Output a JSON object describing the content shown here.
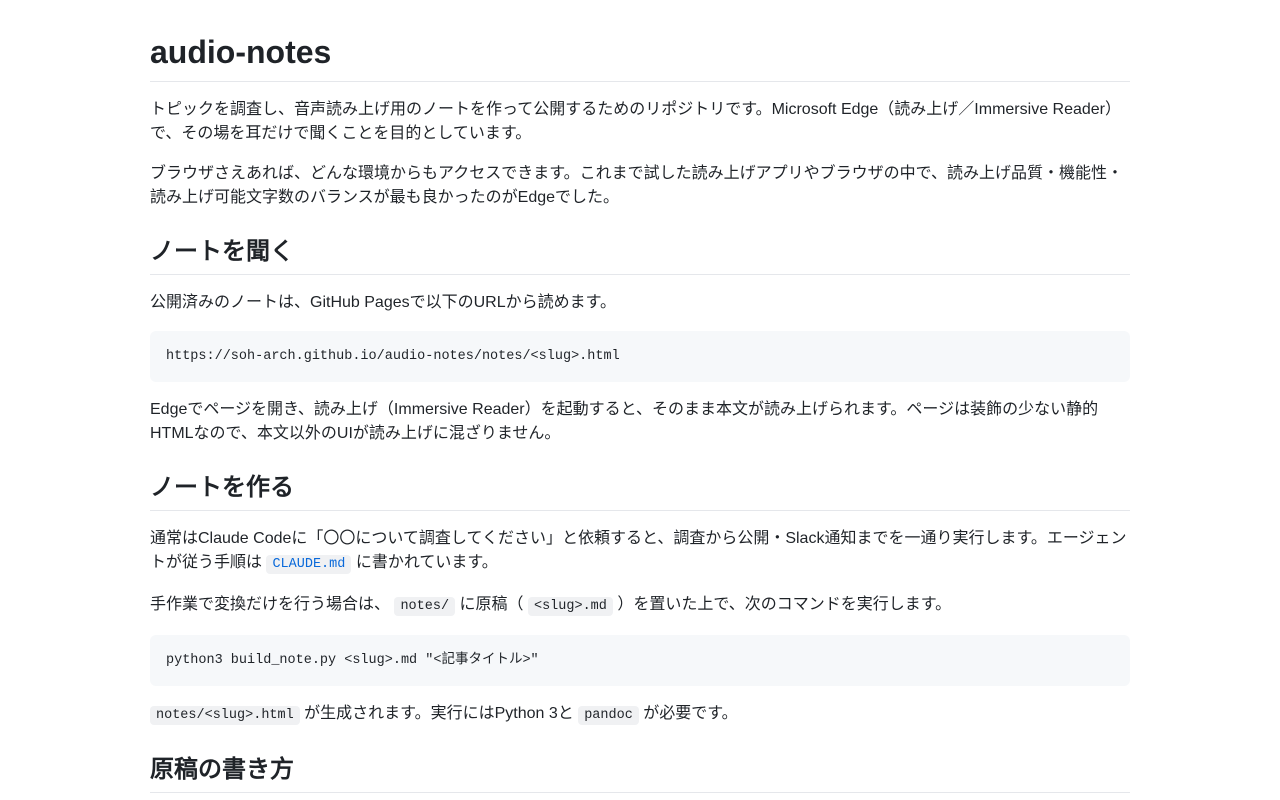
{
  "title": "audio-notes",
  "intro": {
    "p1": "トピックを調査し、音声読み上げ用のノートを作って公開するためのリポジトリです。Microsoft Edge（読み上げ／Immersive Reader）で、その場を耳だけで聞くことを目的としています。",
    "p2": "ブラウザさえあれば、どんな環境からもアクセスできます。これまで試した読み上げアプリやブラウザの中で、読み上げ品質・機能性・読み上げ可能文字数のバランスが最も良かったのがEdgeでした。"
  },
  "listen": {
    "heading": "ノートを聞く",
    "p1": "公開済みのノートは、GitHub Pagesで以下のURLから読めます。",
    "url_code": "https://soh-arch.github.io/audio-notes/notes/<slug>.html",
    "p2": "Edgeでページを開き、読み上げ（Immersive Reader）を起動すると、そのまま本文が読み上げられます。ページは装飾の少ない静的HTMLなので、本文以外のUIが読み上げに混ざりません。"
  },
  "make": {
    "heading": "ノートを作る",
    "p1_before": "通常はClaude Codeに「〇〇について調査してください」と依頼すると、調査から公開・Slack通知までを一通り実行します。エージェントが従う手順は ",
    "p1_code": "CLAUDE.md",
    "p1_after": " に書かれています。",
    "p2_part1": "手作業で変換だけを行う場合は、 ",
    "p2_code1": "notes/",
    "p2_part2": " に原稿（ ",
    "p2_code2": "<slug>.md",
    "p2_part3": " ）を置いた上で、次のコマンドを実行します。",
    "command": "python3 build_note.py <slug>.md \"<記事タイトル>\"",
    "p3_code1": "notes/<slug>.html",
    "p3_part1": " が生成されます。実行にはPython 3と ",
    "p3_code2": "pandoc",
    "p3_part2": " が必要です。"
  },
  "draft": {
    "heading": "原稿の書き方"
  },
  "colors": {
    "text": "#1f2328",
    "code_bg": "#f6f8fa",
    "link": "#0969da",
    "divider": "#e5e7eb"
  }
}
